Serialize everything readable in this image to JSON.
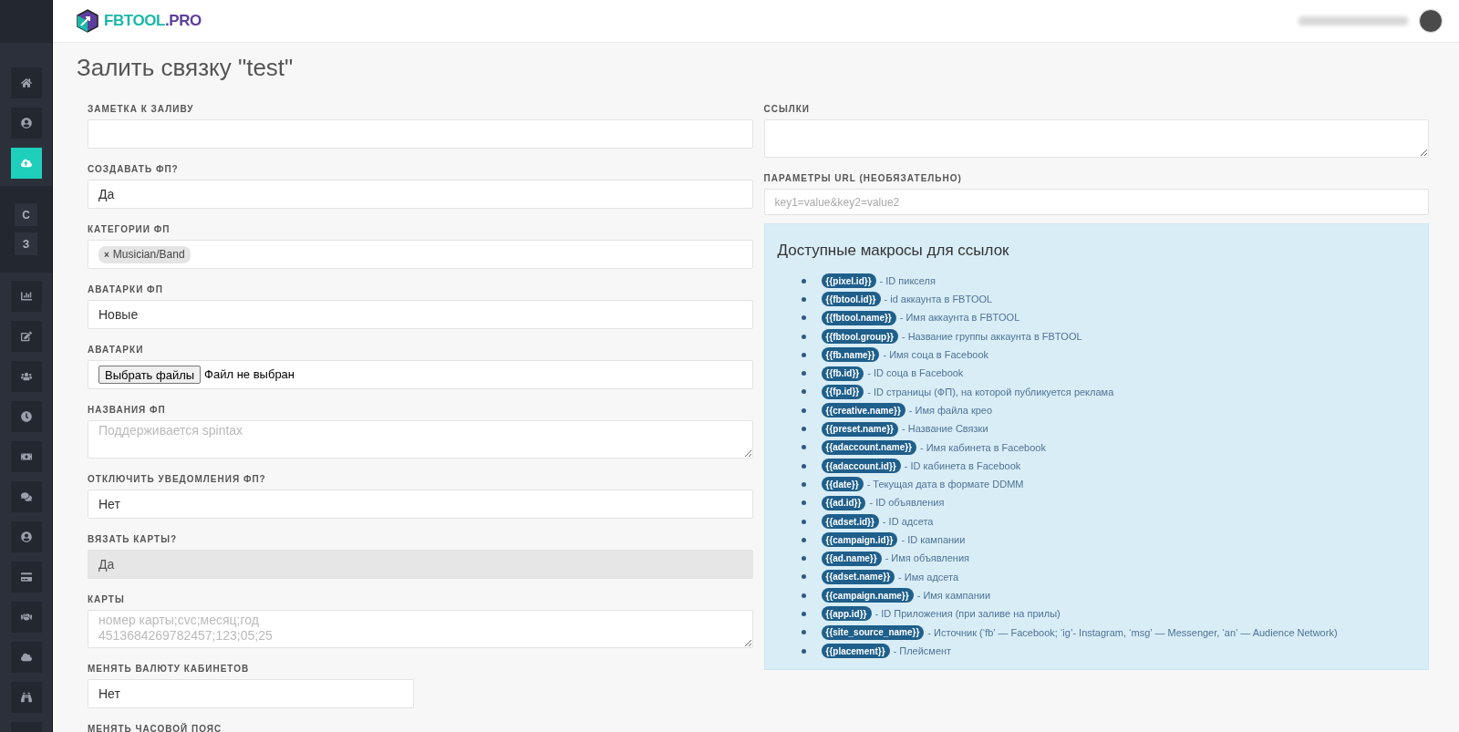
{
  "logo": {
    "name": "FBTOOL",
    "suffix": ".PRO"
  },
  "sidebar": {
    "groups": [
      {
        "kind": "icons",
        "items": [
          {
            "kind": "icon",
            "selected": false
          },
          {
            "kind": "icon",
            "selected": false
          },
          {
            "kind": "icon",
            "selected": true
          }
        ]
      },
      {
        "kind": "letters",
        "items": [
          {
            "kind": "letter",
            "label": "C",
            "selected": false
          },
          {
            "kind": "letter",
            "label": "З",
            "selected": false
          }
        ]
      },
      {
        "kind": "icons",
        "items": [
          {
            "kind": "icon",
            "selected": false
          },
          {
            "kind": "icon",
            "selected": false
          },
          {
            "kind": "icon",
            "selected": false
          },
          {
            "kind": "icon",
            "selected": false
          },
          {
            "kind": "icon",
            "selected": false
          },
          {
            "kind": "icon",
            "selected": false
          },
          {
            "kind": "icon",
            "selected": false
          },
          {
            "kind": "icon",
            "selected": false
          },
          {
            "kind": "icon",
            "selected": false
          },
          {
            "kind": "icon",
            "selected": false
          },
          {
            "kind": "icon",
            "selected": false
          },
          {
            "kind": "icon",
            "selected": false
          }
        ]
      }
    ]
  },
  "page_title": "Залить связку \"test\"",
  "left_fields": [
    {
      "label": "ЗАМЕТКА К ЗАЛИВУ",
      "kind": "input",
      "disabled": false
    },
    {
      "label": "СОЗДАВАТЬ ФП?",
      "kind": "select",
      "value": "Да",
      "disabled": false
    },
    {
      "label": "КАТЕГОРИИ ФП",
      "kind": "tags",
      "tags": [
        {
          "remove": "×",
          "text": "Musician/Band"
        }
      ],
      "disabled": false
    },
    {
      "label": "АВАТАРКИ ФП",
      "kind": "select",
      "value": "Новые",
      "disabled": false
    },
    {
      "label": "АВАТАРКИ",
      "kind": "file",
      "button": "Выбрать файлы",
      "status": "Файл не выбран",
      "disabled": false
    },
    {
      "label": "НАЗВАНИЯ ФП",
      "kind": "textarea",
      "placeholder": "Поддерживается spintax",
      "disabled": false
    },
    {
      "label": "ОТКЛЮЧИТЬ УВЕДОМЛЕНИЯ ФП?",
      "kind": "select",
      "value": "Нет",
      "disabled": false
    },
    {
      "label": "ВЯЗАТЬ КАРТЫ?",
      "kind": "select",
      "value": "Да",
      "disabled": true
    },
    {
      "label": "КАРТЫ",
      "kind": "textarea",
      "placeholder": "номер карты;cvc;месяц;год\n4513684269782457;123;05;25",
      "disabled": false
    }
  ],
  "currency": {
    "label": "МЕНЯТЬ ВАЛЮТУ КАБИНЕТОВ",
    "value": "Нет"
  },
  "timezone": {
    "label": "МЕНЯТЬ ЧАСОВОЙ ПОЯС"
  },
  "links": {
    "label": "ССЫЛКИ"
  },
  "url_params": {
    "label": "ПАРАМЕТРЫ URL (НЕОБЯЗАТЕЛЬНО)",
    "placeholder": "key1=value&key2=value2"
  },
  "macros": {
    "title": "Доступные макросы для ссылок",
    "items": [
      {
        "macro": "{{pixel.id}}",
        "description": "- ID пикселя"
      },
      {
        "macro": "{{fbtool.id}}",
        "description": "- id аккаунта в FBTOOL"
      },
      {
        "macro": "{{fbtool.name}}",
        "description": "- Имя аккаунта в FBTOOL"
      },
      {
        "macro": "{{fbtool.group}}",
        "description": "- Название группы аккаунта в FBTOOL"
      },
      {
        "macro": "{{fb.name}}",
        "description": "- Имя соца в Facebook"
      },
      {
        "macro": "{{fb.id}}",
        "description": "- ID соца в Facebook"
      },
      {
        "macro": "{{fp.id}}",
        "description": "- ID страницы (ФП), на которой публикуется реклама"
      },
      {
        "macro": "{{creative.name}}",
        "description": "- Имя файла крео"
      },
      {
        "macro": "{{preset.name}}",
        "description": "- Название Связки"
      },
      {
        "macro": "{{adaccount.name}}",
        "description": "- Имя кабинета в Facebook"
      },
      {
        "macro": "{{adaccount.id}}",
        "description": "- ID кабинета в Facebook"
      },
      {
        "macro": "{{date}}",
        "description": "- Текущая дата в формате DDMM"
      },
      {
        "macro": "{{ad.id}}",
        "description": "- ID объявления"
      },
      {
        "macro": "{{adset.id}}",
        "description": "- ID адсета"
      },
      {
        "macro": "{{campaign.id}}",
        "description": "- ID кампании"
      },
      {
        "macro": "{{ad.name}}",
        "description": "- Имя объявления"
      },
      {
        "macro": "{{adset.name}}",
        "description": "- Имя адсета"
      },
      {
        "macro": "{{campaign.name}}",
        "description": "- Имя кампании"
      },
      {
        "macro": "{{app.id}}",
        "description": "- ID Приложения (при заливе на прилы)"
      },
      {
        "macro": "{{site_source_name}}",
        "description": "- Источник (‘fb’ — Facebook; ‘ig’- Instagram, ‘msg’ — Messenger, ‘an’ — Audience Network)"
      },
      {
        "macro": "{{placement}}",
        "description": "- Плейсмент"
      }
    ]
  }
}
